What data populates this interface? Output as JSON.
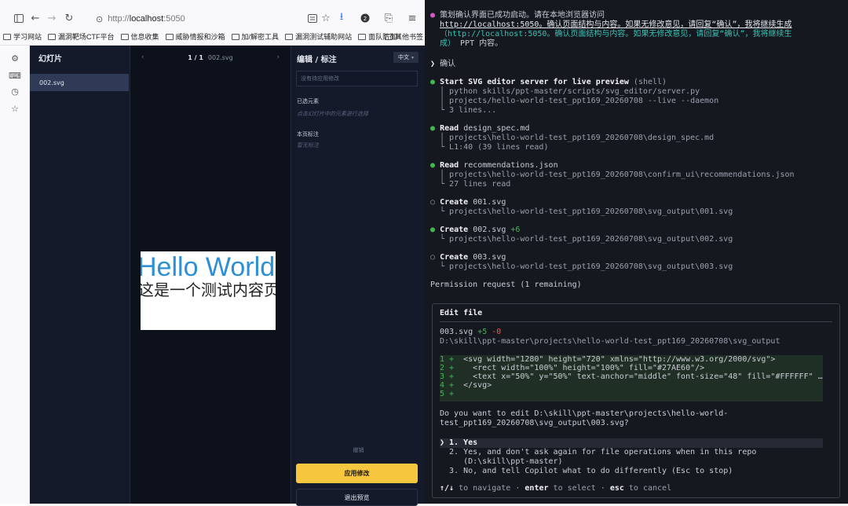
{
  "browser": {
    "url_scheme": "http://",
    "url_host": "localhost",
    "url_port": ":5050",
    "bookmarks": [
      "学习网站",
      "漏洞靶场CTF平台",
      "信息收集",
      "威胁情报和沙箱",
      "加/解密工具",
      "漏洞测试辅助网站",
      "面队防御"
    ],
    "bookmarks_more": "»",
    "bookmarks_other": "其他书签"
  },
  "app": {
    "slides_title": "幻灯片",
    "slide_items": [
      "002.svg"
    ],
    "page_counter": "1 / 1",
    "current_file": "002.svg",
    "slide_text_line1": "Hello World",
    "slide_text_line2": "这是一个测试内容页",
    "edit_title": "编辑 / 标注",
    "lang_label": "中文",
    "pending_placeholder": "没有待应用修改",
    "selected_label": "已选元素",
    "selected_hint": "点击幻灯片中的元素进行选择",
    "note_label": "本页标注",
    "note_hint": "暂无标注",
    "undo_label": "撤销",
    "apply_label": "应用修改",
    "exit_label": "退出预览"
  },
  "terminal": {
    "intro_line1": "策划确认界面已成功启动。请在本地浏览器访问",
    "intro_line2a": "http://localhost:5050",
    "intro_line2b": "。确认页面结构与内容。如果无修改意见，请回复“确认”，我将继续生成",
    "intro_line3": "（http://localhost:5050。确认页面结构与内容。如果无修改意见，请回复“确认”，我将继续生",
    "intro_line4a": "成）",
    "intro_line4b": "PPT 内容。",
    "prompt_prefix": "❯",
    "prompt_text": "确认",
    "step1_title": "Start SVG editor server for live preview",
    "step1_tag": "(shell)",
    "step1_l1": "python skills/ppt-master/scripts/svg_editor/server.py",
    "step1_l2": "projects/hello-world-test_ppt169_20260708 --live --daemon",
    "step1_l3": "3 lines...",
    "step2_title": "Read",
    "step2_file": "design_spec.md",
    "step2_l1": "projects\\hello-world-test_ppt169_20260708\\design_spec.md",
    "step2_l2": "L1:40 (39 lines read)",
    "step3_title": "Read",
    "step3_file": "recommendations.json",
    "step3_l1": "projects\\hello-world-test_ppt169_20260708\\confirm_ui\\recommendations.json",
    "step3_l2": "27 lines read",
    "step4_title": "Create",
    "step4_file": "001.svg",
    "step4_l1": "projects\\hello-world-test_ppt169_20260708\\svg_output\\001.svg",
    "step5_title": "Create",
    "step5_file": "002.svg",
    "step5_added": "+6",
    "step5_l1": "projects\\hello-world-test_ppt169_20260708\\svg_output\\002.svg",
    "step6_title": "Create",
    "step6_file": "003.svg",
    "step6_l1": "projects\\hello-world-test_ppt169_20260708\\svg_output\\003.svg",
    "permission_line": "Permission request (1 remaining)",
    "perm_title": "Edit file",
    "perm_file": "003.svg",
    "perm_added": "+5",
    "perm_removed": "-0",
    "perm_path": "D:\\skill\\ppt-master\\projects\\hello-world-test_ppt169_20260708\\svg_output",
    "diff": [
      {
        "n": "1 +",
        "code": "  <svg width=\"1280\" height=\"720\" xmlns=\"http://www.w3.org/2000/svg\">"
      },
      {
        "n": "2 +",
        "code": "    <rect width=\"100%\" height=\"100%\" fill=\"#27AE60\"/>"
      },
      {
        "n": "3 +",
        "code": "    <text x=\"50%\" y=\"50%\" text-anchor=\"middle\" font-size=\"48\" fill=\"#FFFFFF\" …"
      },
      {
        "n": "4 +",
        "code": "  </svg>"
      },
      {
        "n": "5 +",
        "code": ""
      }
    ],
    "question_l1": "Do you want to edit D:\\skill\\ppt-master\\projects\\hello-world-",
    "question_l2": "test_ppt169_20260708\\svg_output\\003.svg?",
    "opt1": "❯ 1. Yes",
    "opt2a": "  2. Yes, and don't ask again for file operations when in this repo",
    "opt2b": "     (D:\\skill\\ppt-master)",
    "opt3": "  3. No, and tell Copilot what to do differently (Esc to stop)",
    "nav_arrows": "↑/↓",
    "nav_t1": "to navigate ·",
    "nav_k2": "enter",
    "nav_t2": "to select ·",
    "nav_k3": "esc",
    "nav_t3": "to cancel"
  },
  "colors": {
    "accent_yellow": "#f6c63f",
    "slide_blue": "#2d8fd5",
    "terminal_bg": "#161820",
    "diff_green": "#3fb950"
  }
}
